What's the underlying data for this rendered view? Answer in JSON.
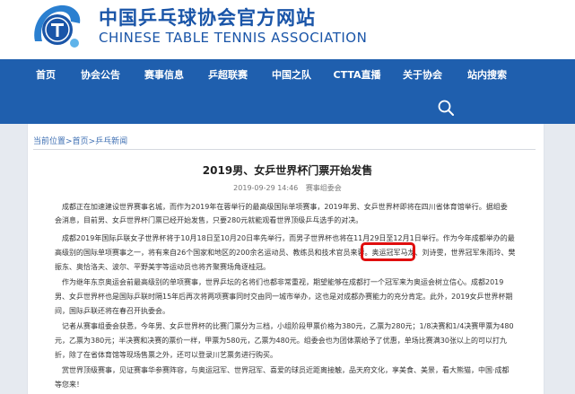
{
  "site": {
    "title_cn": "中国乒乓球协会官方网站",
    "title_en": "CHINESE TABLE TENNIS ASSOCIATION"
  },
  "nav": {
    "items": [
      "首页",
      "协会公告",
      "赛事信息",
      "乒超联赛",
      "中国之队",
      "CTTA直播",
      "关于协会",
      "站内搜索"
    ]
  },
  "breadcrumb": {
    "items": [
      "当前位置",
      "首页",
      "乒乓新闻"
    ],
    "separator": ">"
  },
  "article": {
    "title": "2019男、女乒世界杯门票开始发售",
    "date": "2019-09-29 14:46",
    "source": "赛事组委会",
    "lines": [
      "成都正在加速建设世界赛事名城，而作为2019年在蓉举行的最高级国际单项赛事，2019年男、女乒世界杯即将在四川省体育馆举行。据组委",
      "会消息，目前男、女乒世界杯门票已经开始发售，只要280元就能观看世界顶级乒乓选手的对决。",
      "成都2019年国际乒联女子世界杯将于10月18日至10月20日率先举行，而男子世界杯也将在11月29日至12月1日举行。作为今年成都举办的最",
      "高级别的国际单项赛事之一，将有来自26个国家和地区的200余名运动员、教练员和技术官员来蓉。奥运冠军马龙、刘诗雯，世界冠军朱雨玲、樊",
      "振东、奥恰洛夫、波尔、平野美宇等运动员也将齐聚赛场角逐桂冠。",
      "作为继年东京奥运会前最高级别的单项赛事，世界乒坛的名将们也都非常重视，期望能够在成都打一个冠军来为奥运会树立信心。成都2019",
      "男、女乒世界杯也是国际乒联时隔15年后再次将两项赛事同时交由同一城市举办，这也是对成都办赛能力的充分肯定。此外，2019女乒世界杯期",
      "间，国际乒联还将在春召开执委会。",
      "记者从赛事组委会获悉，今年男、女乒世界杯的比赛门票分为三档，小组阶段甲票价格为380元，乙票为280元；1/8决赛和1/4决赛甲票为480",
      "元，乙票为380元；半决赛和决赛的票价一样，甲票为580元，乙票为480元。组委会也为团体票给予了优惠，单场比赛满30张以上的可以打九",
      "折，除了在省体育馆等现场售票之外，还可以登录川艺票务进行购买。",
      "赏世界顶级赛事，见证赛事华参赛阵容，与奥运冠军、世界冠军、喜爱的球员近距离接触，品天府文化，享美食、美景，看大熊猫，中国·成都",
      "等您来！"
    ]
  },
  "colors": {
    "brand_blue": "#1f5fae",
    "highlight_red": "#e00e0e"
  }
}
